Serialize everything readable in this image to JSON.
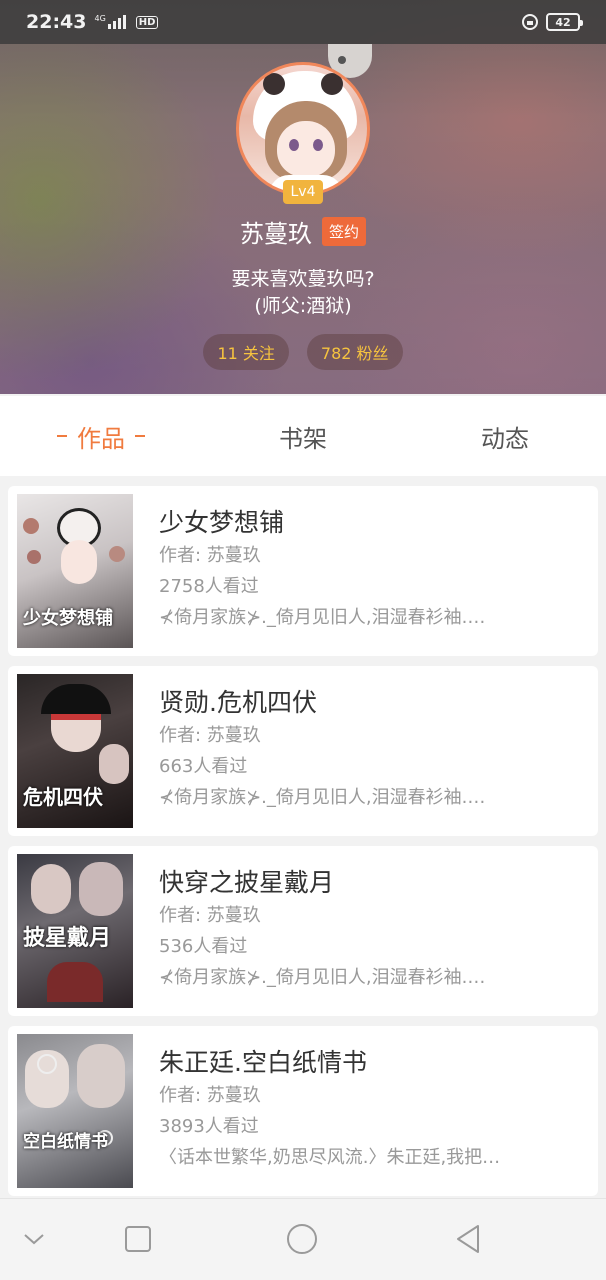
{
  "status_bar": {
    "time": "22:43",
    "network": "4G",
    "hd": "HD",
    "battery": "42"
  },
  "profile": {
    "level": "Lv4",
    "username": "苏蔓玖",
    "sign_badge": "签约",
    "bio_line1": "要来喜欢蔓玖吗?",
    "bio_line2": "(师父:酒狱)",
    "following": "11 关注",
    "followers": "782 粉丝"
  },
  "tabs": [
    {
      "label": "作品",
      "active": true
    },
    {
      "label": "书架",
      "active": false
    },
    {
      "label": "动态",
      "active": false
    }
  ],
  "works": [
    {
      "title": "少女梦想铺",
      "author": "作者: 苏蔓玖",
      "views": "2758人看过",
      "summary": "⊀倚月家族⊁._倚月见旧人,泪湿春衫袖.…",
      "cover_text": "少女梦想铺"
    },
    {
      "title": "贤勋.危机四伏",
      "author": "作者: 苏蔓玖",
      "views": "663人看过",
      "summary": "⊀倚月家族⊁._倚月见旧人,泪湿春衫袖.…",
      "cover_text": "危机四伏"
    },
    {
      "title": "快穿之披星戴月",
      "author": "作者: 苏蔓玖",
      "views": "536人看过",
      "summary": "⊀倚月家族⊁._倚月见旧人,泪湿春衫袖.…",
      "cover_text": "披星戴月"
    },
    {
      "title": "朱正廷.空白纸情书",
      "author": "作者: 苏蔓玖",
      "views": "3893人看过",
      "summary": "〈话本世繁华,奶思尽风流.〉朱正廷,我把…",
      "cover_text": "空白纸情书"
    }
  ],
  "colors": {
    "accent": "#f07b3f",
    "level_badge": "#f1b43e",
    "sign_badge": "#ee6a3a",
    "stat_text": "#f6c33f"
  }
}
